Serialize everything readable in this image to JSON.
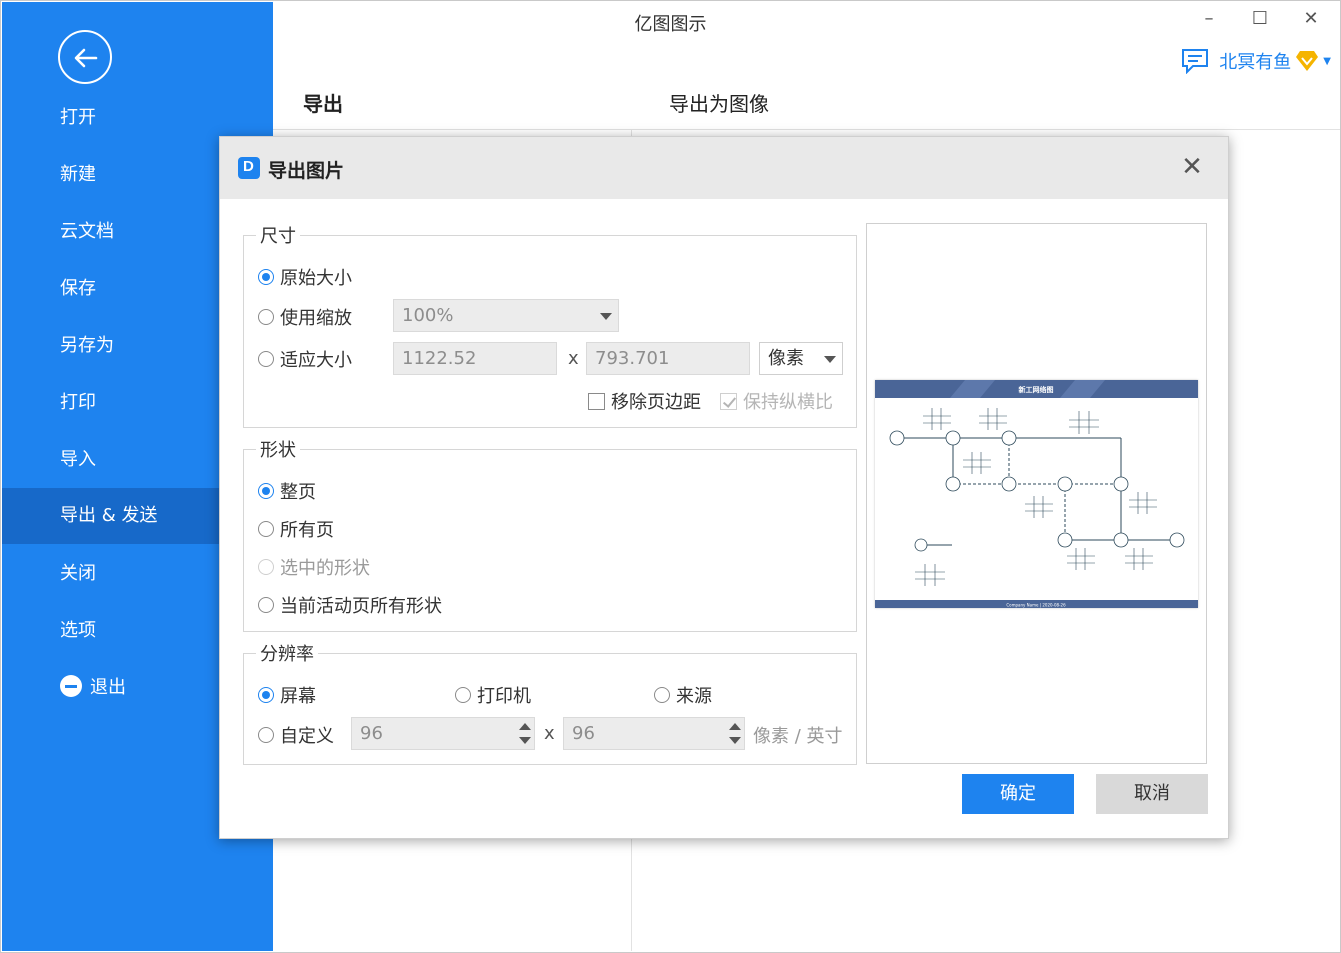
{
  "app": {
    "title": "亿图图示",
    "user_name": "北冥有鱼",
    "window_controls": {
      "minimize": "–",
      "maximize": "☐",
      "close": "✕"
    }
  },
  "sidebar": {
    "items": [
      {
        "label": "打开"
      },
      {
        "label": "新建"
      },
      {
        "label": "云文档"
      },
      {
        "label": "保存"
      },
      {
        "label": "另存为"
      },
      {
        "label": "打印"
      },
      {
        "label": "导入"
      },
      {
        "label": "导出 & 发送",
        "active": true
      },
      {
        "label": "关闭"
      },
      {
        "label": "选项"
      },
      {
        "label": "退出"
      }
    ]
  },
  "main": {
    "left_header": "导出",
    "right_header": "导出为图像"
  },
  "dialog": {
    "title": "导出图片",
    "close_glyph": "✕",
    "size": {
      "label": "尺寸",
      "original": "原始大小",
      "use_scale": "使用缩放",
      "scale_value": "100%",
      "fit_size": "适应大小",
      "width": "1122.52",
      "height": "793.701",
      "x_sep": "x",
      "unit": "像素",
      "remove_margin": "移除页边距",
      "keep_ratio": "保持纵横比"
    },
    "shape": {
      "label": "形状",
      "whole_page": "整页",
      "all_pages": "所有页",
      "selected_shapes": "选中的形状",
      "current_page_all": "当前活动页所有形状"
    },
    "resolution": {
      "label": "分辨率",
      "screen": "屏幕",
      "printer": "打印机",
      "source": "来源",
      "custom": "自定义",
      "dpi_x": "96",
      "dpi_y": "96",
      "x_sep": "x",
      "unit": "像素 / 英寸"
    },
    "preview": {
      "header": "新工网络图",
      "footer": "Company Name | 2020-08-26"
    },
    "ok": "确定",
    "cancel": "取消"
  },
  "colors": {
    "accent": "#1e83ef",
    "sidebar_active": "#1769c9",
    "preview_bar": "#4a6597"
  }
}
